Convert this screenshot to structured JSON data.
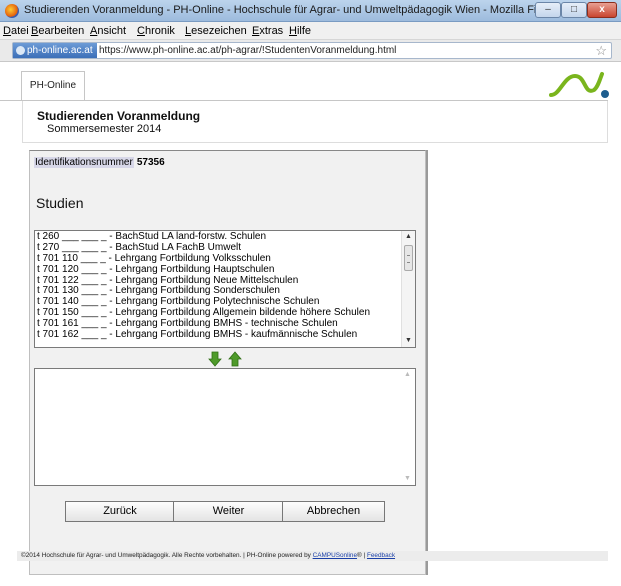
{
  "window": {
    "title": "Studierenden Voranmeldung - PH-Online - Hochschule für Agrar- und Umweltpädagogik Wien - Mozilla Firefox",
    "minimize": "–",
    "maximize": "□",
    "close": "x"
  },
  "menu": [
    "Datei",
    "Bearbeiten",
    "Ansicht",
    "Chronik",
    "Lesezeichen",
    "Extras",
    "Hilfe"
  ],
  "urlbar": {
    "site_badge": "ph-online.ac.at",
    "url": "https://www.ph-online.ac.at/ph-agrar/!StudentenVoranmeldung.html",
    "star": "☆"
  },
  "page": {
    "tab_label": "PH-Online",
    "title": "Studierenden Voranmeldung",
    "subtitle": "Sommersemester 2014",
    "ident_label": "Identifikationsnummer",
    "ident_value": "57356",
    "section_title": "Studien",
    "studies": [
      "t 260 ___ ___ _ - BachStud LA land-forstw. Schulen",
      "t 270 ___ ___ _ - BachStud LA FachB Umwelt",
      "t 701 110 ___ _ - Lehrgang Fortbildung Volksschulen",
      "t 701 120 ___ _ - Lehrgang Fortbildung Hauptschulen",
      "t 701 122 ___ _ - Lehrgang Fortbildung Neue Mittelschulen",
      "t 701 130 ___ _ - Lehrgang Fortbildung Sonderschulen",
      "t 701 140 ___ _ - Lehrgang Fortbildung Polytechnische Schulen",
      "t 701 150 ___ _ - Lehrgang Fortbildung Allgemein bildende höhere Schulen",
      "t 701 161 ___ _ - Lehrgang Fortbildung BMHS - technische Schulen",
      "t 701 162 ___ _ - Lehrgang Fortbildung BMHS - kaufmännische Schulen"
    ],
    "buttons": {
      "back": "Zurück",
      "next": "Weiter",
      "cancel": "Abbrechen"
    },
    "footer": {
      "text": "©2014 Hochschule für Agrar- und Umweltpädagogik. Alle Rechte vorbehalten. | PH-Online powered by ",
      "campus_link": "CAMPUSonline",
      "reg": "® | ",
      "feedback_link": "Feedback"
    }
  },
  "colors": {
    "logo_green": "#7ab51d",
    "logo_dot": "#1d5d8e",
    "arrow_green": "#4e9a2a"
  }
}
